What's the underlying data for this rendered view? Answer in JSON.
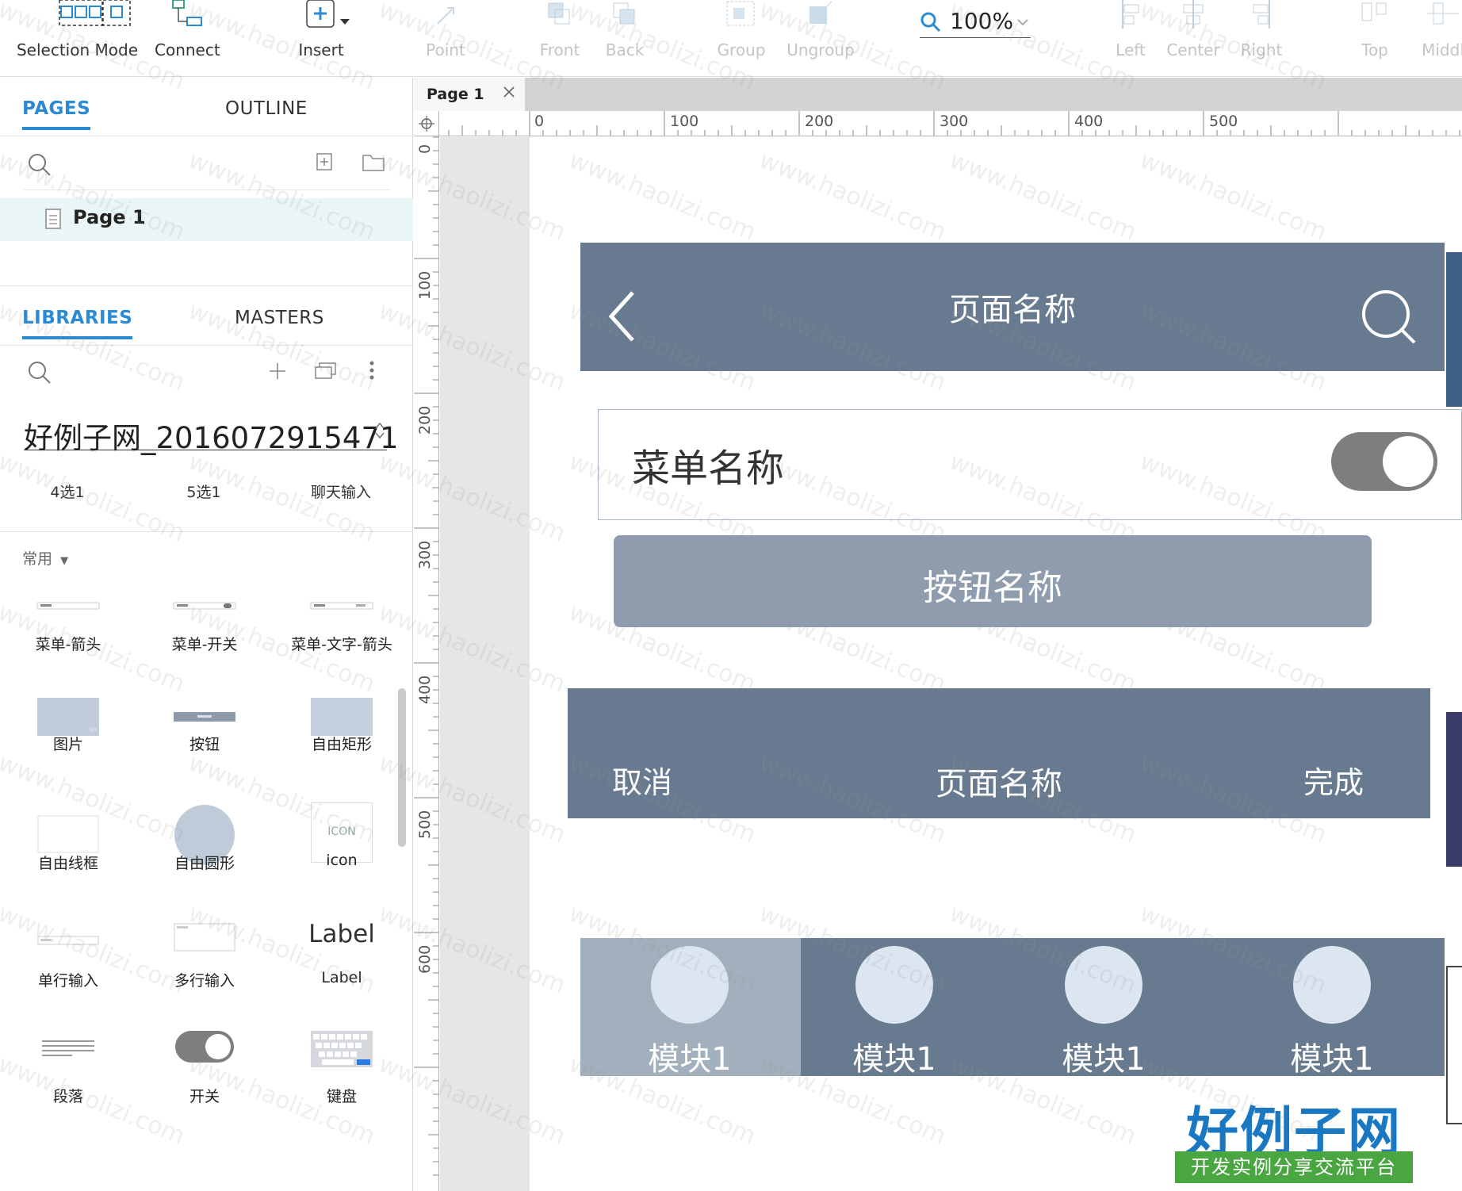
{
  "toolbar": {
    "selection_mode": "Selection Mode",
    "connect": "Connect",
    "insert": "Insert",
    "point": "Point",
    "front": "Front",
    "back": "Back",
    "group": "Group",
    "ungroup": "Ungroup",
    "zoom": "100%",
    "left": "Left",
    "center": "Center",
    "right": "Right",
    "top": "Top",
    "middle": "Middl"
  },
  "pages_panel": {
    "tab_pages": "PAGES",
    "tab_outline": "OUTLINE",
    "page_item": "Page 1"
  },
  "libraries_panel": {
    "tab_libraries": "LIBRARIES",
    "tab_masters": "MASTERS",
    "library_name": "好例子网_2016072915471",
    "quick_items": [
      "4选1",
      "5选1",
      "聊天输入"
    ],
    "group_label": "常用",
    "widgets": [
      "菜单-箭头",
      "菜单-开关",
      "菜单-文字-箭头",
      "图片",
      "按钮",
      "自由矩形",
      "自由线框",
      "自由圆形",
      "icon",
      "单行输入",
      "多行输入",
      "Label",
      "段落",
      "开关",
      "键盘"
    ],
    "icon_thumb_text": "ICON",
    "label_thumb_text": "Label"
  },
  "document_tab": {
    "title": "Page 1"
  },
  "rulers": {
    "horizontal": [
      "0",
      "100",
      "200",
      "300",
      "400",
      "500"
    ],
    "vertical": [
      "0",
      "100",
      "200",
      "300",
      "400",
      "500",
      "600"
    ]
  },
  "canvas": {
    "nav_bar_title": "页面名称",
    "menu_title": "菜单名称",
    "button_title": "按钮名称",
    "nav2_left": "取消",
    "nav2_title": "页面名称",
    "nav2_right": "完成",
    "tab_items": [
      "模块1",
      "模块1",
      "模块1",
      "模块1"
    ]
  },
  "watermark": {
    "text": "www.haolizi.com",
    "logo_title": "好例子网",
    "logo_subtitle": "开发实例分享交流平台"
  },
  "colors": {
    "accent": "#2a8ad4",
    "nav_bg": "#687a8f",
    "button_bg": "#8f9cad",
    "tab_selected": "#a2b0be"
  }
}
